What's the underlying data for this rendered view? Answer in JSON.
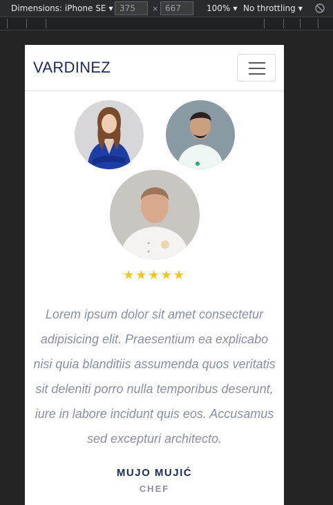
{
  "devtools": {
    "dimensions_label": "Dimensions: iPhone SE",
    "width": "375",
    "height": "667",
    "times": "×",
    "zoom": "100%",
    "throttling": "No throttling",
    "caret": "▼",
    "rotate_icon": "rotate-icon"
  },
  "site": {
    "brand": "VARDINEZ",
    "menu_icon": "hamburger-icon",
    "stars": "★★★★★",
    "testimonial": "Lorem ipsum dolor sit amet consectetur adipisicing elit. Praesentium ea explicabo nisi quia blanditiis assumenda quos veritatis sit deleniti porro nulla temporibus deserunt, iure in labore incidunt quis eos. Accusamus sed excepturi architecto.",
    "name": "MUJO MUJIĆ",
    "role": "CHEF"
  },
  "colors": {
    "brand": "#1a2a5c",
    "star": "#f5c518",
    "quote": "#8a8fa3"
  }
}
